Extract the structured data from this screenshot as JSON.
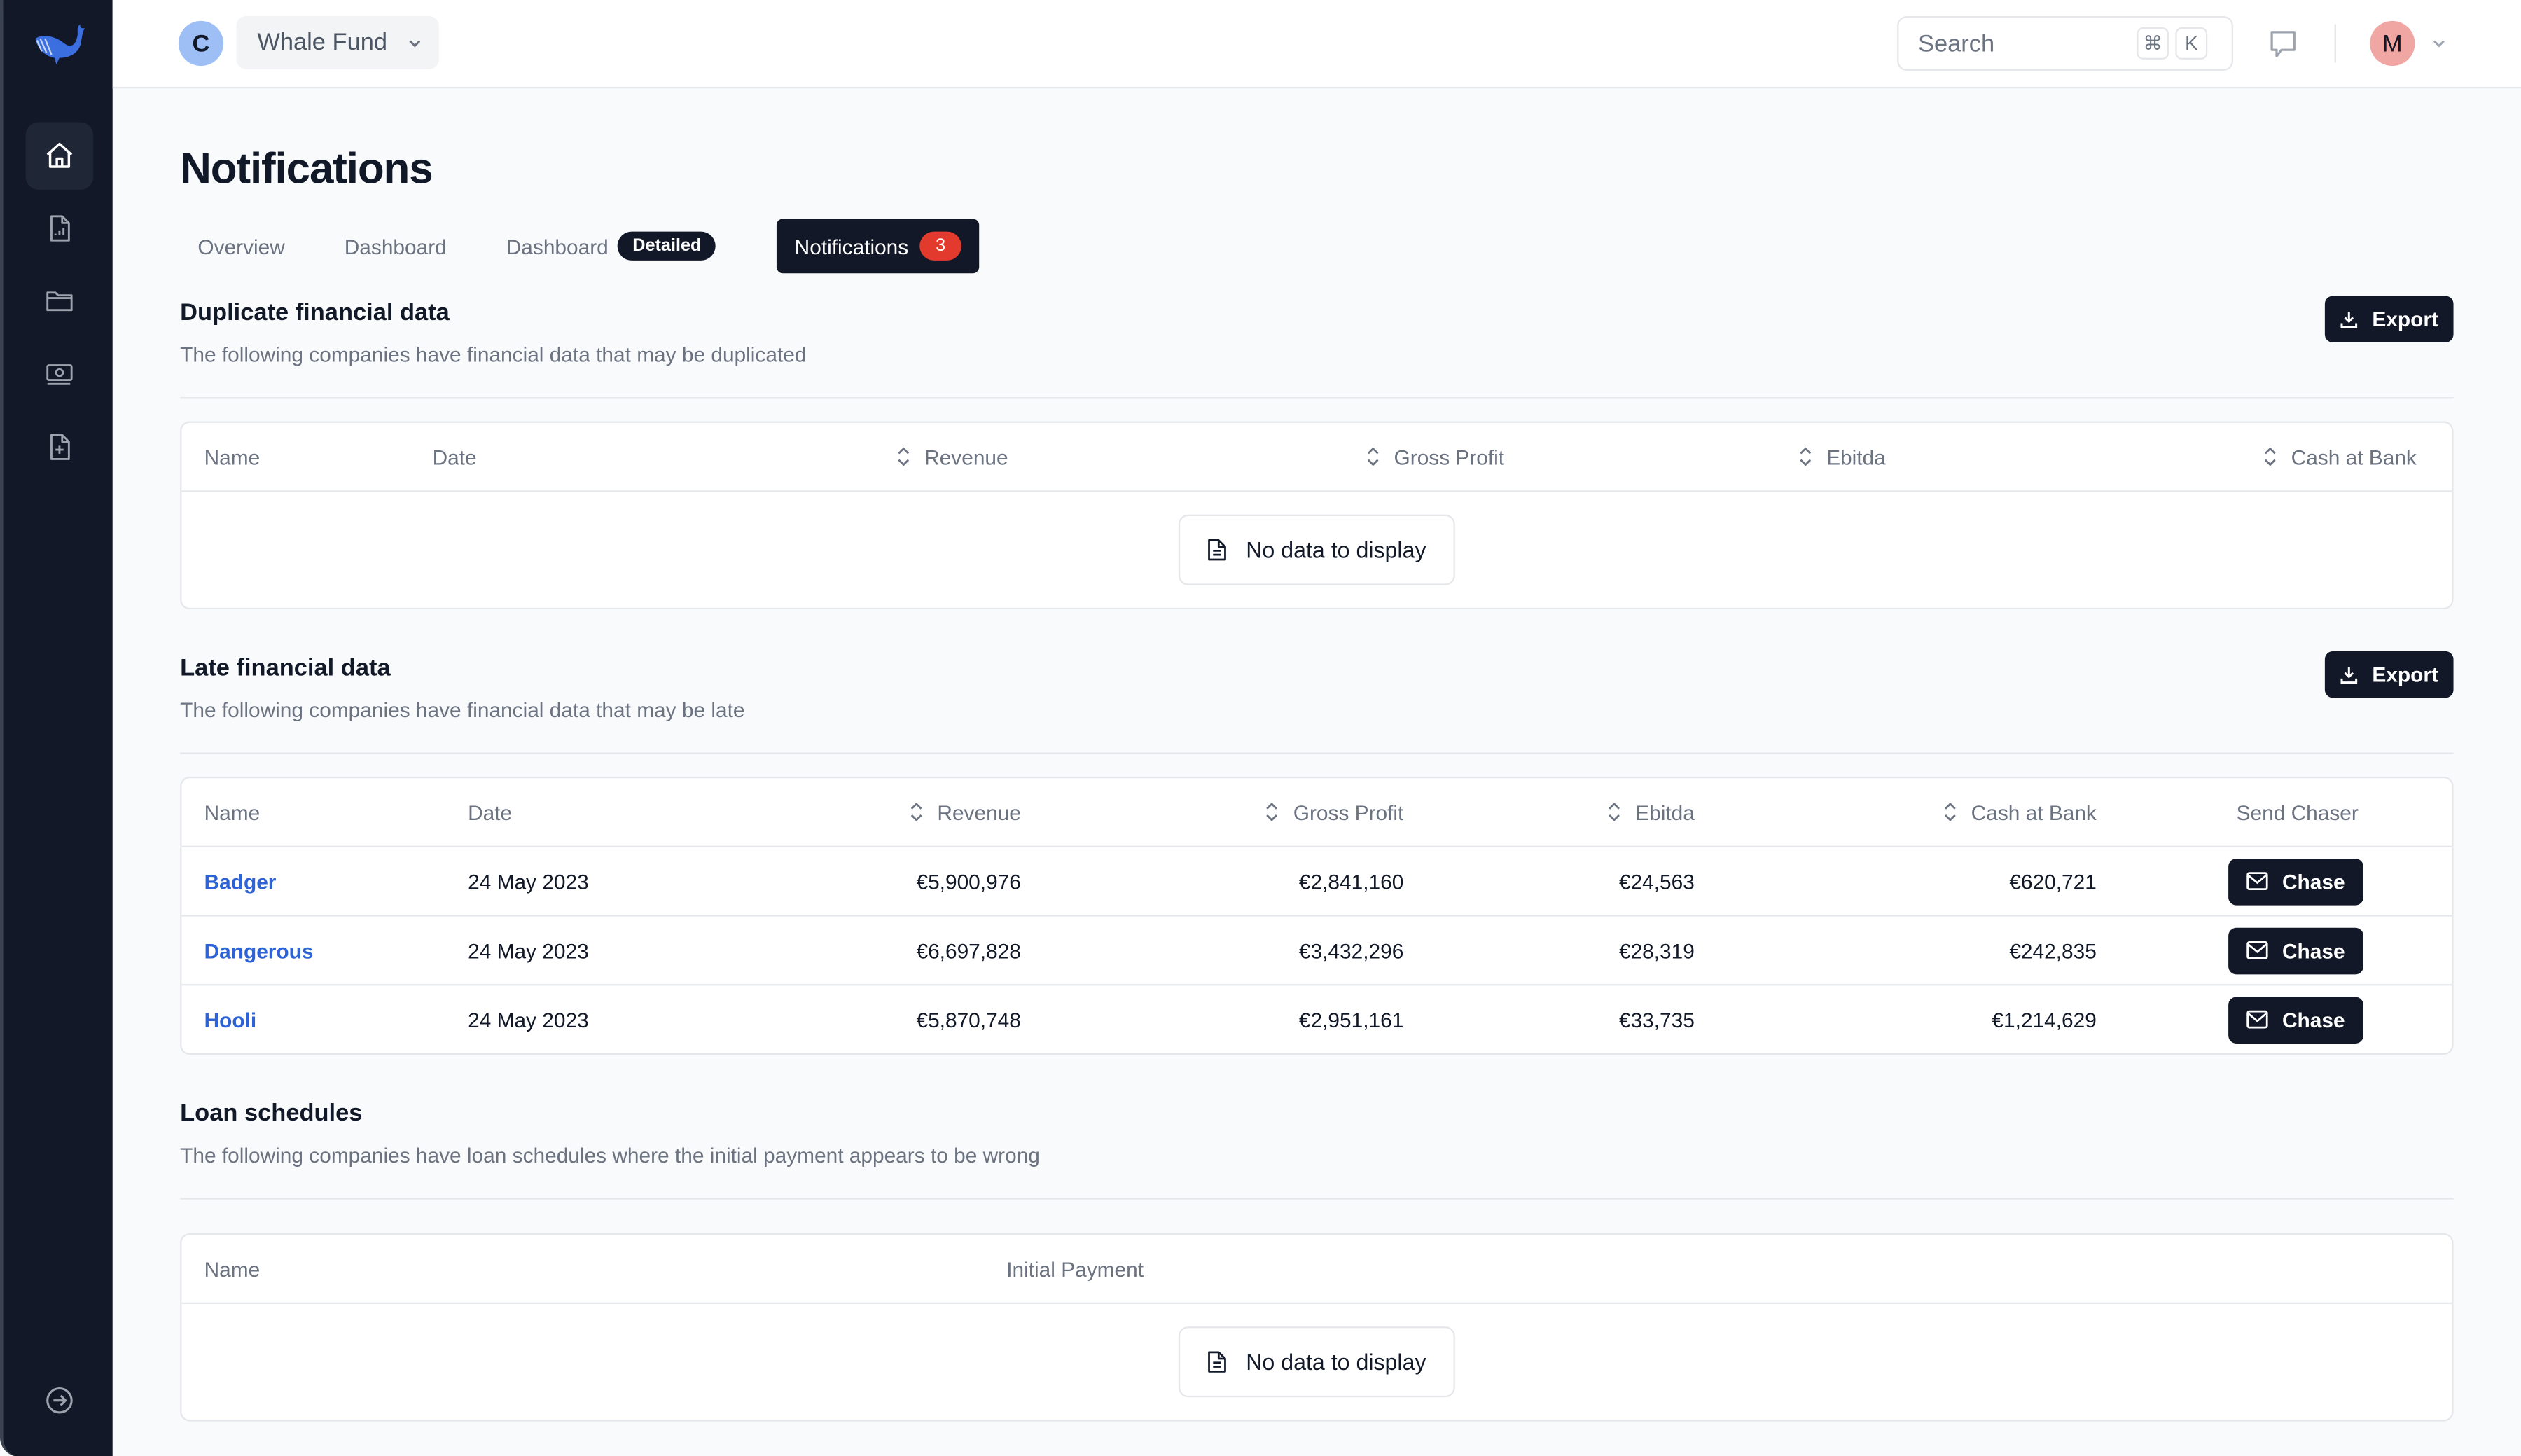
{
  "app": {
    "org_initial": "C",
    "org_name": "Whale Fund",
    "user_initial": "M",
    "search": {
      "placeholder": "Search",
      "shortcut_mod": "⌘",
      "shortcut_key": "K"
    }
  },
  "sidebar": {
    "items": [
      {
        "icon": "home-icon",
        "label": "Home",
        "active": true
      },
      {
        "icon": "file-chart-icon",
        "label": "Reports",
        "active": false
      },
      {
        "icon": "folder-icon",
        "label": "Folders",
        "active": false
      },
      {
        "icon": "banknotes-icon",
        "label": "Payments",
        "active": false
      },
      {
        "icon": "file-plus-icon",
        "label": "New document",
        "active": false
      }
    ],
    "footer_icon": "arrow-right-circle-icon"
  },
  "page": {
    "title": "Notifications",
    "tabs": [
      {
        "label": "Overview"
      },
      {
        "label": "Dashboard"
      },
      {
        "label": "Dashboard",
        "badge": "Detailed"
      },
      {
        "label": "Notifications",
        "count": "3",
        "active": true
      }
    ]
  },
  "colors": {
    "accent_dark": "#121827",
    "link": "#2e63d6",
    "badge_red": "#e23b2e",
    "sidebar_bg": "#121827"
  },
  "sections": {
    "duplicate": {
      "title": "Duplicate financial data",
      "description": "The following companies have financial data that may be duplicated",
      "export_label": "Export",
      "columns": [
        "Name",
        "Date",
        "Revenue",
        "Gross Profit",
        "Ebitda",
        "Cash at Bank"
      ],
      "empty_label": "No data to display"
    },
    "late": {
      "title": "Late financial data",
      "description": "The following companies have financial data that may be late",
      "export_label": "Export",
      "columns": [
        "Name",
        "Date",
        "Revenue",
        "Gross Profit",
        "Ebitda",
        "Cash at Bank",
        "Send Chaser"
      ],
      "rows": [
        {
          "name": "Badger",
          "date": "24 May 2023",
          "revenue": "€5,900,976",
          "gross_profit": "€2,841,160",
          "ebitda": "€24,563",
          "cash_at_bank": "€620,721",
          "action": "Chase"
        },
        {
          "name": "Dangerous",
          "date": "24 May 2023",
          "revenue": "€6,697,828",
          "gross_profit": "€3,432,296",
          "ebitda": "€28,319",
          "cash_at_bank": "€242,835",
          "action": "Chase"
        },
        {
          "name": "Hooli",
          "date": "24 May 2023",
          "revenue": "€5,870,748",
          "gross_profit": "€2,951,161",
          "ebitda": "€33,735",
          "cash_at_bank": "€1,214,629",
          "action": "Chase"
        }
      ]
    },
    "loans": {
      "title": "Loan schedules",
      "description": "The following companies have loan schedules where the initial payment appears to be wrong",
      "columns": [
        "Name",
        "Initial Payment"
      ],
      "empty_label": "No data to display"
    }
  }
}
